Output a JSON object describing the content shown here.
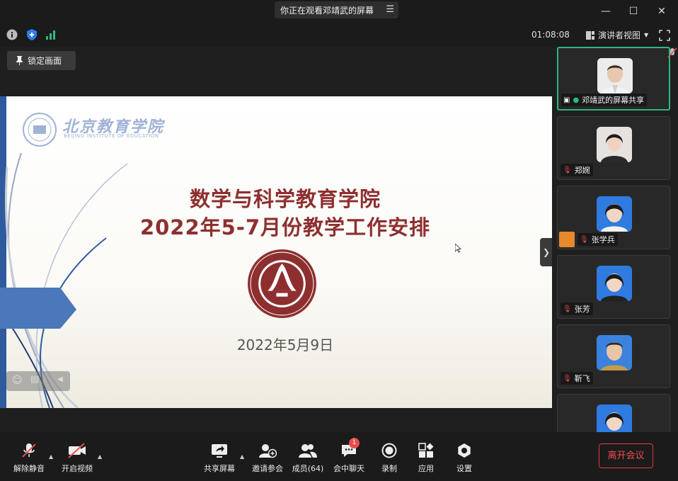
{
  "titlebar": {
    "banner": "你正在观看邓靖武的屏幕"
  },
  "infobar": {
    "timer": "01:08:08",
    "view_mode": "演讲者视图"
  },
  "main": {
    "lock_button": "锁定画面"
  },
  "slide": {
    "logo_cn": "北京教育学院",
    "logo_en": "BEIJING INSTITUTE OF EDUCATION",
    "title_line1": "数学与科学教育学院",
    "title_line2": "2022年5-7月份教学工作安排",
    "date": "2022年5月9日"
  },
  "gallery": {
    "tiles": [
      {
        "name": "邓靖武的屏幕共享"
      },
      {
        "name": "郑婉"
      },
      {
        "name": "张学兵"
      },
      {
        "name": "张芳"
      },
      {
        "name": "靳飞"
      }
    ]
  },
  "toolbar": {
    "unmute": "解除静音",
    "start_video": "开启视频",
    "share_screen": "共享屏幕",
    "invite": "邀请参会",
    "members": "成员(64)",
    "chat": "会中聊天",
    "chat_badge": "1",
    "record": "录制",
    "apps": "应用",
    "settings": "设置",
    "leave": "离开会议"
  },
  "colors": {
    "accent_green": "#2db87d",
    "leave_red": "#e0383e",
    "slide_title": "#8e2f2f"
  }
}
